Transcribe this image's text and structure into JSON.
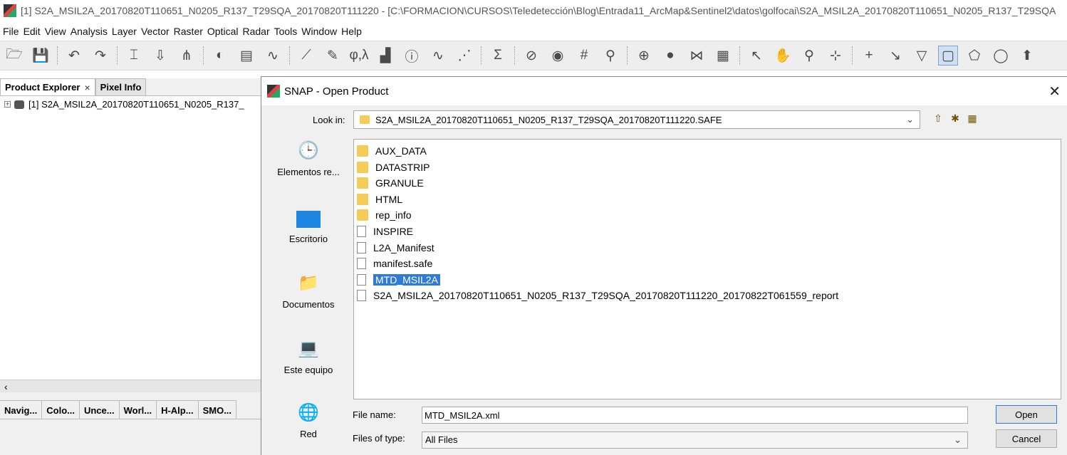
{
  "window": {
    "title": "[1] S2A_MSIL2A_20170820T110651_N0205_R137_T29SQA_20170820T111220 - [C:\\FORMACION\\CURSOS\\Teledetección\\Blog\\Entrada11_ArcMap&Sentinel2\\datos\\golfocai\\S2A_MSIL2A_20170820T110651_N0205_R137_T29SQA"
  },
  "menu": [
    "File",
    "Edit",
    "View",
    "Analysis",
    "Layer",
    "Vector",
    "Raster",
    "Optical",
    "Radar",
    "Tools",
    "Window",
    "Help"
  ],
  "toolbar": {
    "icons": [
      "open-product-icon",
      "save-product-icon",
      "undo-icon",
      "redo-icon",
      "band-maths-icon",
      "band-subset-icon",
      "band-merge-icon",
      "color-palette-icon",
      "layers-icon",
      "wave-icon",
      "polygon-draw-icon",
      "pencil-icon",
      "geo-coord-icon",
      "histogram-icon",
      "info-icon",
      "spectrum-icon",
      "scatter-icon",
      "statistics-icon",
      "magic-wand-icon",
      "eye-icon",
      "grid-icon",
      "pin-icon",
      "gcp-icon",
      "gcp-manager-icon",
      "graph-icon",
      "layout-grid-icon",
      "pointer-icon",
      "pan-hand-icon",
      "zoom-icon",
      "range-finder-icon",
      "gcp-add-icon",
      "line-draw-icon",
      "polyline-draw-icon",
      "rectangle-draw-icon",
      "polygon-add-icon",
      "ellipse-draw-icon",
      "insert-pin-icon"
    ],
    "glyphs": {
      "open-product-icon": "🗁",
      "save-product-icon": "💾",
      "undo-icon": "↶",
      "redo-icon": "↷",
      "band-maths-icon": "⌶",
      "band-subset-icon": "⇩",
      "band-merge-icon": "⋔",
      "color-palette-icon": "◐",
      "layers-icon": "▤",
      "wave-icon": "∿",
      "polygon-draw-icon": "⟋",
      "pencil-icon": "✎",
      "geo-coord-icon": "φ,λ",
      "histogram-icon": "▟",
      "info-icon": "ⓘ",
      "spectrum-icon": "∿",
      "scatter-icon": "⋰",
      "statistics-icon": "Σ",
      "magic-wand-icon": "⊘",
      "eye-icon": "◉",
      "grid-icon": "#",
      "pin-icon": "⚲",
      "gcp-icon": "⊕",
      "gcp-manager-icon": "●",
      "graph-icon": "⋈",
      "layout-grid-icon": "▦",
      "pointer-icon": "↖",
      "pan-hand-icon": "✋",
      "zoom-icon": "⚲",
      "range-finder-icon": "⊹",
      "gcp-add-icon": "+",
      "line-draw-icon": "↘",
      "polyline-draw-icon": "▽",
      "rectangle-draw-icon": "▢",
      "polygon-add-icon": "⬠",
      "ellipse-draw-icon": "◯",
      "insert-pin-icon": "⬆"
    }
  },
  "left_panel": {
    "tabs": [
      {
        "label": "Product Explorer",
        "closable": true,
        "active": true
      },
      {
        "label": "Pixel Info",
        "closable": false,
        "active": false
      }
    ],
    "tree_item": "[1] S2A_MSIL2A_20170820T110651_N0205_R137_",
    "scroll_left": "‹",
    "bottom_tabs": [
      "Navig...",
      "Colo...",
      "Unce...",
      "Worl...",
      "H-Alp...",
      "SMO..."
    ]
  },
  "dialog": {
    "title": "SNAP - Open Product",
    "close_glyph": "✕",
    "look_in_label": "Look in:",
    "look_in_value": "S2A_MSIL2A_20170820T110651_N0205_R137_T29SQA_20170820T111220.SAFE",
    "nav_icons": [
      "up-folder-icon",
      "new-folder-icon",
      "view-menu-icon"
    ],
    "places": [
      {
        "label": "Elementos re...",
        "icon": "recent-items-icon",
        "glyph": "🕒"
      },
      {
        "label": "Escritorio",
        "icon": "desktop-icon",
        "glyph": ""
      },
      {
        "label": "Documentos",
        "icon": "documents-icon",
        "glyph": "📁"
      },
      {
        "label": "Este equipo",
        "icon": "computer-icon",
        "glyph": "💻"
      },
      {
        "label": "Red",
        "icon": "network-icon",
        "glyph": "🌐"
      }
    ],
    "files": [
      {
        "name": "AUX_DATA",
        "type": "folder"
      },
      {
        "name": "DATASTRIP",
        "type": "folder"
      },
      {
        "name": "GRANULE",
        "type": "folder"
      },
      {
        "name": "HTML",
        "type": "folder"
      },
      {
        "name": "rep_info",
        "type": "folder"
      },
      {
        "name": "INSPIRE",
        "type": "file"
      },
      {
        "name": "L2A_Manifest",
        "type": "file"
      },
      {
        "name": "manifest.safe",
        "type": "file"
      },
      {
        "name": "MTD_MSIL2A",
        "type": "file",
        "selected": true
      },
      {
        "name": "S2A_MSIL2A_20170820T110651_N0205_R137_T29SQA_20170820T111220_20170822T061559_report",
        "type": "file"
      }
    ],
    "file_name_label": "File name:",
    "file_name_value": "MTD_MSIL2A.xml",
    "files_of_type_label": "Files of type:",
    "files_of_type_value": "All Files",
    "open_button": "Open",
    "cancel_button": "Cancel"
  },
  "colors": {
    "accent": "#2f7cd6",
    "folder": "#f5cc5a",
    "toolbar_bg": "#eeeeee"
  }
}
